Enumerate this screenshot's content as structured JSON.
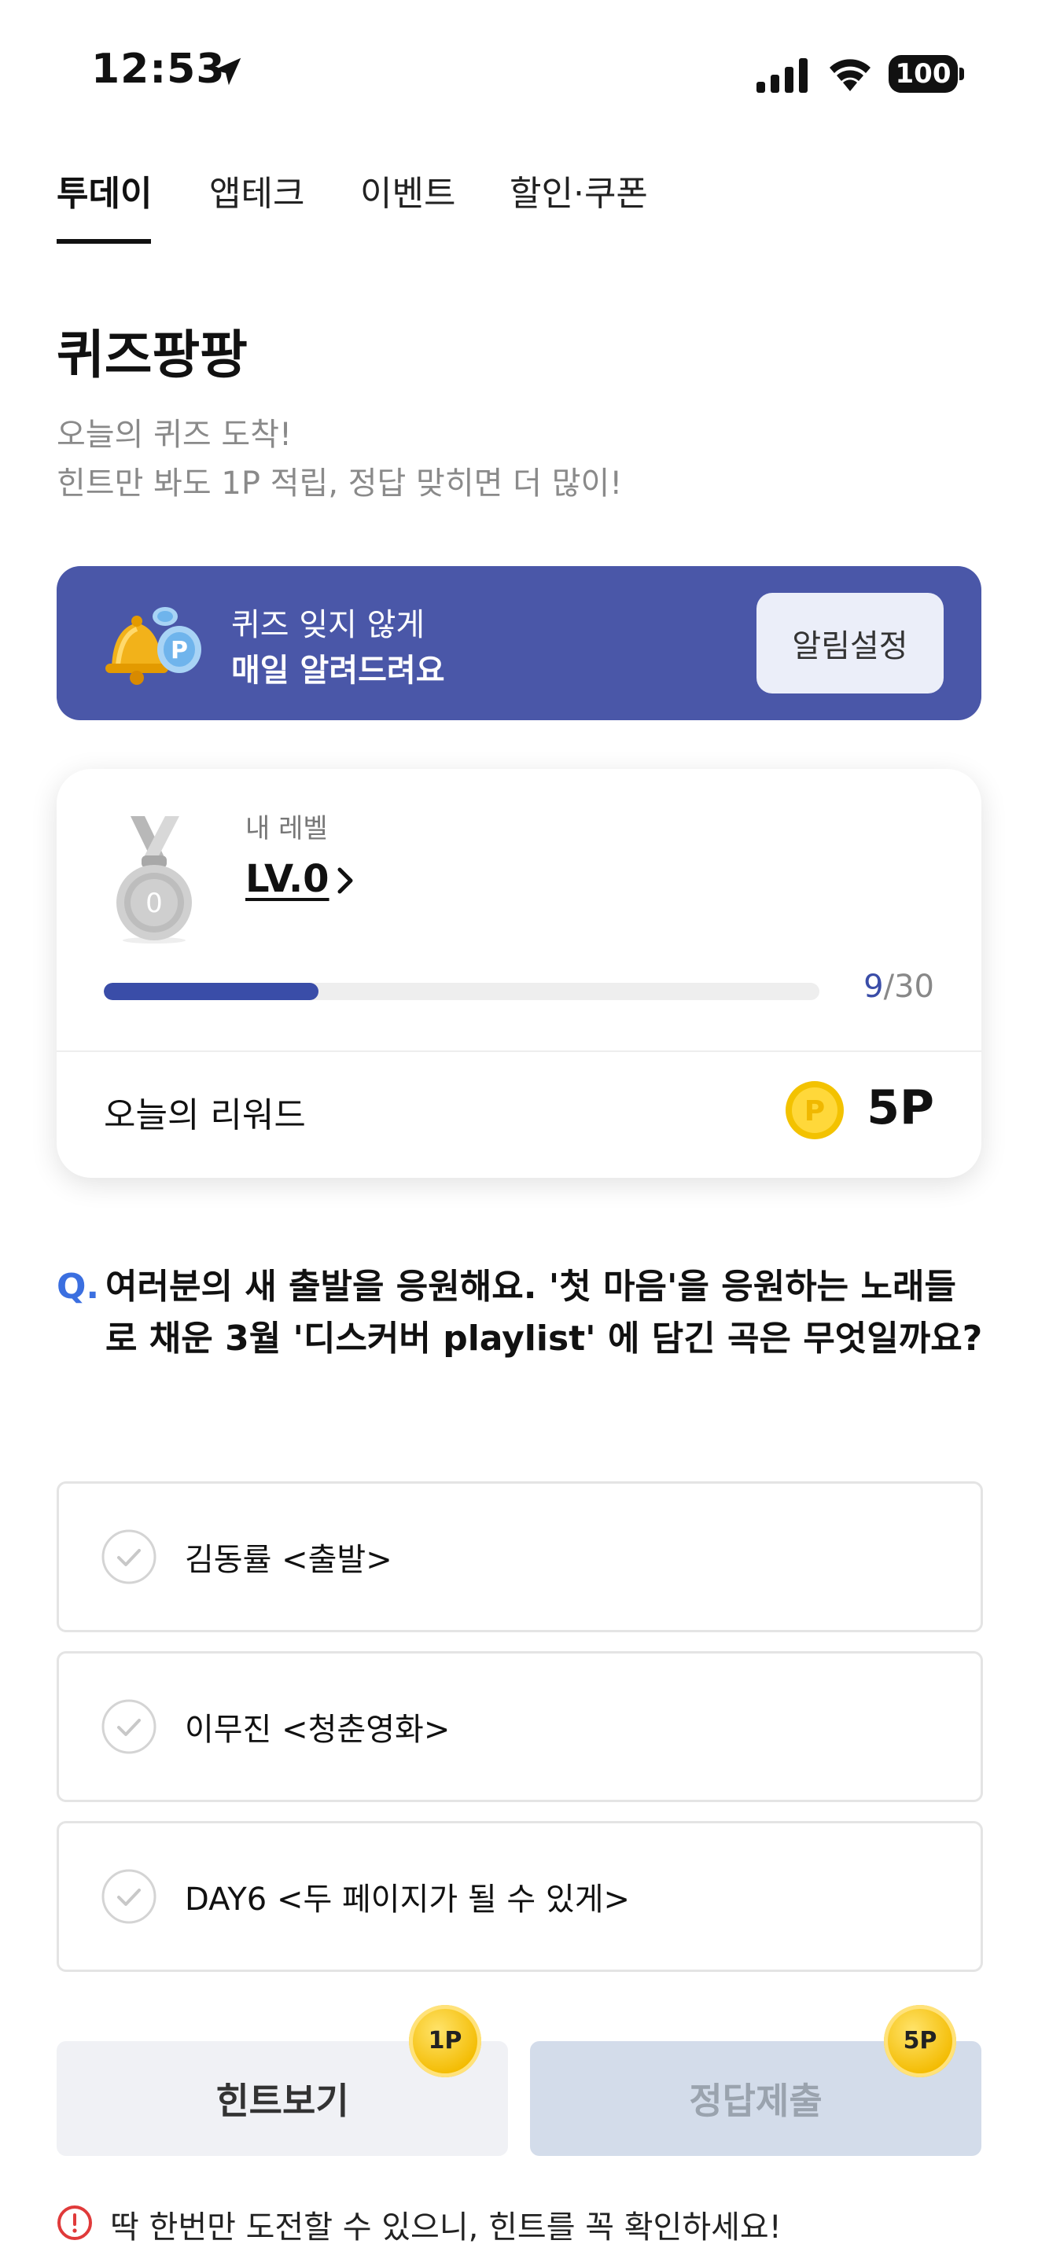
{
  "status_bar": {
    "time": "12:53",
    "battery": "100"
  },
  "tabs": [
    {
      "label": "투데이",
      "active": true
    },
    {
      "label": "앱테크",
      "active": false
    },
    {
      "label": "이벤트",
      "active": false
    },
    {
      "label": "할인·쿠폰",
      "active": false
    }
  ],
  "page": {
    "title": "퀴즈팡팡",
    "subtitle_line1": "오늘의 퀴즈 도착!",
    "subtitle_line2": "힌트만 봐도 1P 적립, 정답 맞히면 더 많이!"
  },
  "alarm_banner": {
    "line1": "퀴즈 잊지 않게",
    "line2": "매일 알려드려요",
    "button": "알림설정",
    "color": "#4a57a8"
  },
  "level_card": {
    "label": "내 레벨",
    "level": "LV.0",
    "medal_number": "0",
    "progress_current": "9",
    "progress_total": "/30",
    "progress_fraction": 0.3,
    "reward_label": "오늘의 리워드",
    "reward_value": "5P",
    "coin_symbol": "P"
  },
  "question": {
    "marker": "Q.",
    "text": "여러분의 새 출발을 응원해요. '첫 마음'을 응원하는 노래들로 채운 3월 '디스커버 playlist' 에 담긴 곡은 무엇일까요?"
  },
  "options": [
    {
      "label": "김동률 <출발>"
    },
    {
      "label": "이무진 <청춘영화>"
    },
    {
      "label": "DAY6 <두 페이지가 될 수 있게>"
    }
  ],
  "buttons": {
    "hint": "힌트보기",
    "hint_badge": "1P",
    "submit": "정답제출",
    "submit_badge": "5P"
  },
  "warning": {
    "text": "딱 한번만 도전할 수 있으니, 힌트를 꼭 확인하세요!"
  },
  "colors": {
    "accent": "#3a4da8",
    "question_marker": "#3b6fe0",
    "warning": "#e03a3a"
  }
}
